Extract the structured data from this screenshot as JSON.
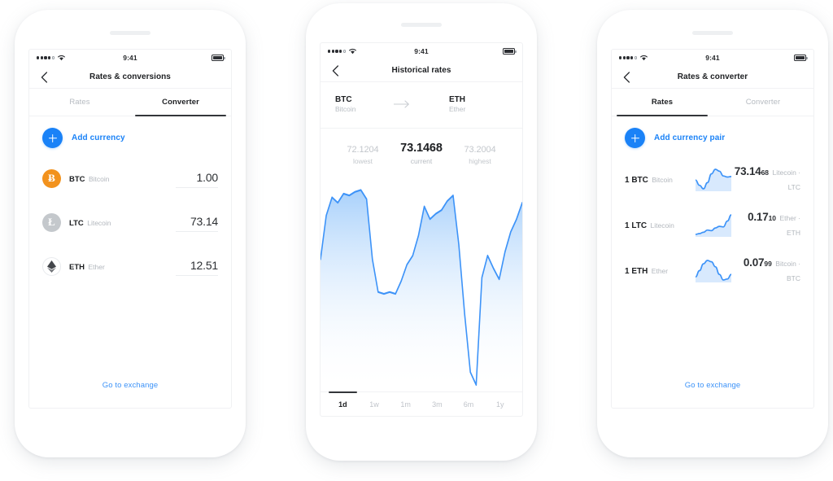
{
  "status_bar": {
    "time": "9:41",
    "signal_dots": 5,
    "signal_filled": 4,
    "wifi_icon": "wifi-icon",
    "battery_icon": "battery-icon"
  },
  "colors": {
    "accent": "#1a82f7",
    "link": "#3d93f8",
    "btc": "#f2921d",
    "ltc": "#c4c8cc",
    "text": "#1d1f22",
    "muted": "#b2b7bd",
    "chart_line": "#3d93f8"
  },
  "phone1": {
    "nav": {
      "back_icon": "back-chevron-icon",
      "title": "Rates & conversions"
    },
    "tabs": [
      {
        "label": "Rates",
        "active": false
      },
      {
        "label": "Converter",
        "active": true
      }
    ],
    "add_action": {
      "icon": "plus-circle-icon",
      "label": "Add currency"
    },
    "rows": [
      {
        "icon": "bitcoin-icon",
        "glyph": "Ƀ",
        "code": "BTC",
        "name": "Bitcoin",
        "value": "1.00"
      },
      {
        "icon": "litecoin-icon",
        "glyph": "Ł",
        "code": "LTC",
        "name": "Litecoin",
        "value": "73.14"
      },
      {
        "icon": "ethereum-icon",
        "glyph": "",
        "code": "ETH",
        "name": "Ether",
        "value": "12.51"
      }
    ],
    "footer_link": "Go to exchange"
  },
  "phone2": {
    "nav": {
      "back_icon": "back-chevron-icon",
      "title": "Historical rates"
    },
    "pair": {
      "from": {
        "code": "BTC",
        "name": "Bitcoin"
      },
      "arrow_icon": "arrow-right-icon",
      "to": {
        "code": "ETH",
        "name": "Ether"
      }
    },
    "stats": [
      {
        "value": "72.1204",
        "label": "lowest"
      },
      {
        "value": "73.1468",
        "label": "current"
      },
      {
        "value": "73.2004",
        "label": "highest"
      }
    ],
    "ranges": [
      {
        "label": "1d",
        "active": true
      },
      {
        "label": "1w",
        "active": false
      },
      {
        "label": "1m",
        "active": false
      },
      {
        "label": "3m",
        "active": false
      },
      {
        "label": "6m",
        "active": false
      },
      {
        "label": "1y",
        "active": false
      }
    ]
  },
  "phone3": {
    "nav": {
      "back_icon": "back-chevron-icon",
      "title": "Rates & converter"
    },
    "tabs": [
      {
        "label": "Rates",
        "active": true
      },
      {
        "label": "Converter",
        "active": false
      }
    ],
    "add_action": {
      "icon": "plus-circle-icon",
      "label": "Add currency pair"
    },
    "rows": [
      {
        "code": "1 BTC",
        "name": "Bitcoin",
        "value": "73.14",
        "value_sub": "68",
        "pair": "Litecoin · LTC",
        "spark": "sparkline-btc"
      },
      {
        "code": "1 LTC",
        "name": "Litecoin",
        "value": "0.17",
        "value_sub": "10",
        "pair": "Ether · ETH",
        "spark": "sparkline-ltc"
      },
      {
        "code": "1 ETH",
        "name": "Ether",
        "value": "0.07",
        "value_sub": "99",
        "pair": "Bitcoin · BTC",
        "spark": "sparkline-eth"
      }
    ],
    "footer_link": "Go to exchange"
  },
  "chart_data": {
    "type": "area",
    "title": "Historical rates BTC to ETH",
    "xlabel": "",
    "ylabel": "",
    "grid": false,
    "legend": "none",
    "ylim": [
      72.1204,
      73.2004
    ],
    "annotations": {
      "lowest": 72.1204,
      "current": 73.1468,
      "highest": 73.2004
    },
    "x": [
      0,
      1,
      2,
      3,
      4,
      5,
      6,
      7,
      8,
      9,
      10,
      11,
      12,
      13,
      14,
      15,
      16,
      17,
      18,
      19,
      20,
      21,
      22,
      23,
      24,
      25,
      26,
      27,
      28,
      29,
      30,
      31,
      32,
      33,
      34,
      35
    ],
    "values": [
      72.82,
      73.06,
      73.16,
      73.13,
      73.18,
      73.17,
      73.19,
      73.2,
      73.15,
      72.82,
      72.64,
      72.63,
      72.64,
      72.63,
      72.7,
      72.79,
      72.84,
      72.95,
      73.11,
      73.04,
      73.07,
      73.09,
      73.14,
      73.17,
      72.9,
      72.52,
      72.2,
      72.13,
      72.72,
      72.84,
      72.77,
      72.71,
      72.86,
      72.97,
      73.04,
      73.13
    ],
    "sparklines": [
      {
        "name": "sparkline-btc",
        "values": [
          0.55,
          0.35,
          0.22,
          0.45,
          0.78,
          0.95,
          0.88,
          0.7,
          0.66,
          0.68
        ]
      },
      {
        "name": "sparkline-ltc",
        "values": [
          0.22,
          0.25,
          0.3,
          0.38,
          0.36,
          0.46,
          0.52,
          0.5,
          0.72,
          0.95
        ]
      },
      {
        "name": "sparkline-eth",
        "values": [
          0.3,
          0.55,
          0.82,
          0.95,
          0.9,
          0.7,
          0.4,
          0.18,
          0.22,
          0.4
        ]
      }
    ]
  }
}
